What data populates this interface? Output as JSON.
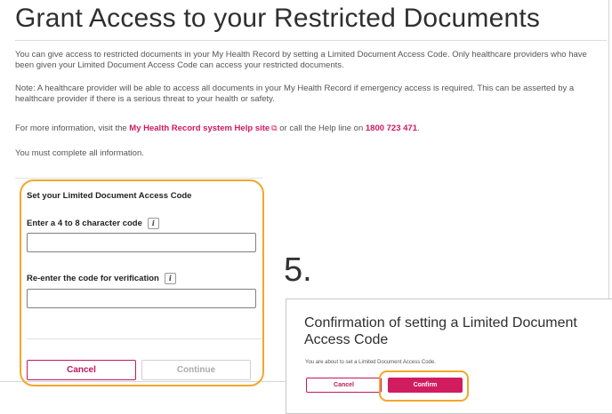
{
  "page": {
    "title": "Grant Access to your Restricted Documents",
    "paragraph1": "You can give access to restricted documents in your My Health Record by setting a Limited Document Access Code. Only healthcare providers who have been given your Limited Document Access Code can access your restricted documents.",
    "paragraph2": "Note: A healthcare provider will be able to access all documents in your My Health Record if emergency access is required. This can be asserted by a healthcare provider if there is a serious threat to your health or safety.",
    "info_prefix": "For more information, visit the ",
    "help_link": "My Health Record system Help site",
    "info_middle": " or call the Help line on ",
    "help_phone": "1800 723 471",
    "info_suffix": ".",
    "requirement": "You must complete all information."
  },
  "form": {
    "heading": "Set your Limited Document Access Code",
    "code_label": "Enter a 4 to 8 character code",
    "code_value": "",
    "verify_label": "Re-enter the code for verification",
    "verify_value": "",
    "cancel_label": "Cancel",
    "continue_label": "Continue"
  },
  "step": {
    "number": "5."
  },
  "modal": {
    "title": "Confirmation of setting a Limited Document Access Code",
    "text": "You are about to set a Limited Document Access Code.",
    "cancel_label": "Cancel",
    "confirm_label": "Confirm"
  },
  "icons": {
    "external_link": "external-link-icon",
    "info": "info-icon"
  },
  "colors": {
    "accent": "#d1185d",
    "highlight": "#f3a72b"
  }
}
